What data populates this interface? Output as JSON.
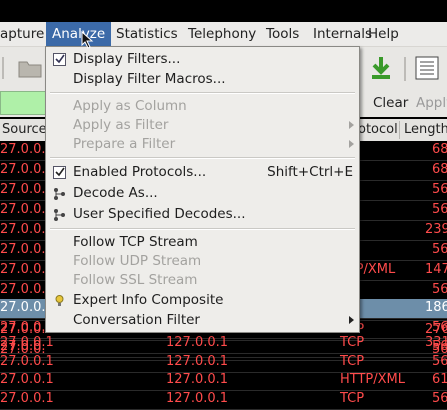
{
  "menubar": {
    "items": [
      "apture",
      "Analyze",
      "Statistics",
      "Telephony",
      "Tools",
      "Internals",
      "Help"
    ]
  },
  "filterbar": {
    "clear_label": "Clear",
    "apply_label": "Apply"
  },
  "columns": [
    "Source",
    "otocol",
    "Length"
  ],
  "packets": [
    {
      "src": "27.0.0.",
      "dst": "",
      "proto": "",
      "len": "68"
    },
    {
      "src": "27.0.0.",
      "dst": "",
      "proto": "",
      "len": "68"
    },
    {
      "src": "27.0.0.",
      "dst": "",
      "proto": "",
      "len": "56"
    },
    {
      "src": "27.0.0.",
      "dst": "",
      "proto": "",
      "len": "56"
    },
    {
      "src": "27.0.0.",
      "dst": "",
      "proto": "",
      "len": "239"
    },
    {
      "src": "27.0.0.",
      "dst": "",
      "proto": "",
      "len": "56"
    },
    {
      "src": "27.0.0.",
      "dst": "",
      "proto": "TTP/XML",
      "len": "147"
    },
    {
      "src": "27.0.0.",
      "dst": "",
      "proto": "",
      "len": "56"
    },
    {
      "src": "27.0.0.",
      "dst": "",
      "proto": "",
      "len": "56"
    },
    {
      "src": "27.0.0.",
      "dst": "",
      "proto": "TCP",
      "len": "276"
    },
    {
      "src": "27.0.0.",
      "dst": "",
      "proto": "",
      "len": "56"
    },
    {
      "src": "27.0.0.",
      "dst": "",
      "proto": "TP",
      "len": "186"
    },
    {
      "src": "27.0.0.",
      "dst": "",
      "proto": "",
      "len": "56"
    },
    {
      "src": "27.0.0.",
      "dst": "",
      "proto": "",
      "len": "56"
    },
    {
      "src": "27.0.0.1",
      "dst": "127.0.0.1",
      "proto": "TCP",
      "len": "331"
    },
    {
      "src": "27.0.0.1",
      "dst": "127.0.0.1",
      "proto": "TCP",
      "len": "56"
    },
    {
      "src": "27.0.0.1",
      "dst": "127.0.0.1",
      "proto": "HTTP/XML",
      "len": "61"
    },
    {
      "src": "27.0.0.1",
      "dst": "127.0.0.1",
      "proto": "TCP",
      "len": "56"
    }
  ],
  "menu": {
    "display_filters": "Display Filters...",
    "display_filter_macros": "Display Filter Macros...",
    "apply_as_column": "Apply as Column",
    "apply_as_filter": "Apply as Filter",
    "prepare_a_filter": "Prepare a Filter",
    "enabled_protocols": "Enabled Protocols...",
    "enabled_protocols_shortcut": "Shift+Ctrl+E",
    "decode_as": "Decode As...",
    "user_specified_decodes": "User Specified Decodes...",
    "follow_tcp_stream": "Follow TCP Stream",
    "follow_udp_stream": "Follow UDP Stream",
    "follow_ssl_stream": "Follow SSL Stream",
    "expert_info_composite": "Expert Info Composite",
    "conversation_filter": "Conversation Filter"
  },
  "colors": {
    "menu_highlight": "#3c6aa8",
    "filter_valid": "#aff0a8",
    "packet_text": "#ff4b4b",
    "selected_row": "#6d8ea9"
  }
}
